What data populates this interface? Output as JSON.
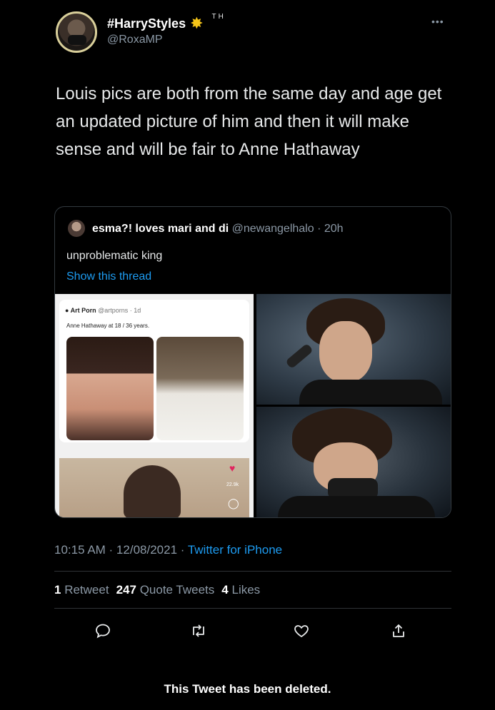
{
  "tweet": {
    "display_name": "#HarryStyles",
    "badge": "TH",
    "handle": "@RoxaMP",
    "more": "•••",
    "text": "Louis pics are both from the same day and age get an updated picture of him and then it will make sense and will  be fair to Anne Hathaway"
  },
  "quote": {
    "name": "esma?! loves mari and di",
    "handle": "@newangelhalo",
    "time": "· 20h",
    "text": "unproblematic king",
    "show_thread": "Show this thread",
    "media": {
      "account": "Art Porn",
      "account_meta": "@artporns · 1d",
      "caption": "Anne Hathaway at 18 / 36 years.",
      "likes": "22.9k"
    }
  },
  "meta": {
    "timestamp": "10:15 AM · 12/08/2021 ·",
    "source": "Twitter for iPhone"
  },
  "stats": {
    "retweets_count": "1",
    "retweets_label": "Retweet",
    "quotes_count": "247",
    "quotes_label": "Quote Tweets",
    "likes_count": "4",
    "likes_label": "Likes"
  },
  "actions": [
    "reply-icon",
    "retweet-icon",
    "like-icon",
    "share-icon"
  ],
  "footer": {
    "deleted_notice": "This Tweet has been deleted."
  },
  "colors": {
    "accent": "#1d9bf0",
    "muted": "#8b98a5",
    "background": "#000000"
  }
}
